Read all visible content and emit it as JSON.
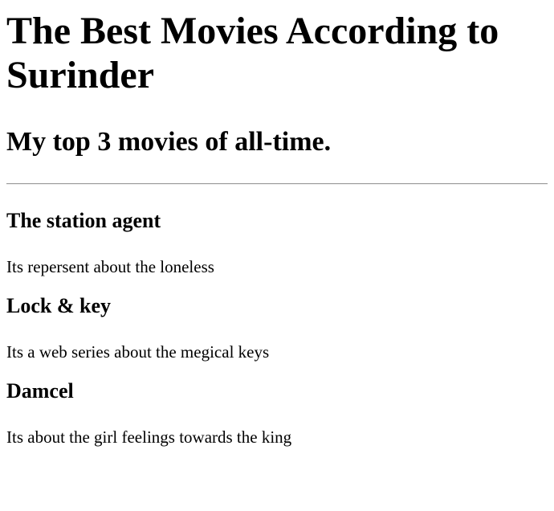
{
  "header": {
    "title": "The Best Movies According to Surinder",
    "subtitle": "My top 3 movies of all-time."
  },
  "movies": [
    {
      "title": "The station agent",
      "description": "Its repersent about the loneless"
    },
    {
      "title": "Lock & key",
      "description": "Its a web series about the megical keys"
    },
    {
      "title": "Damcel",
      "description": "Its about the girl feelings towards the king"
    }
  ]
}
